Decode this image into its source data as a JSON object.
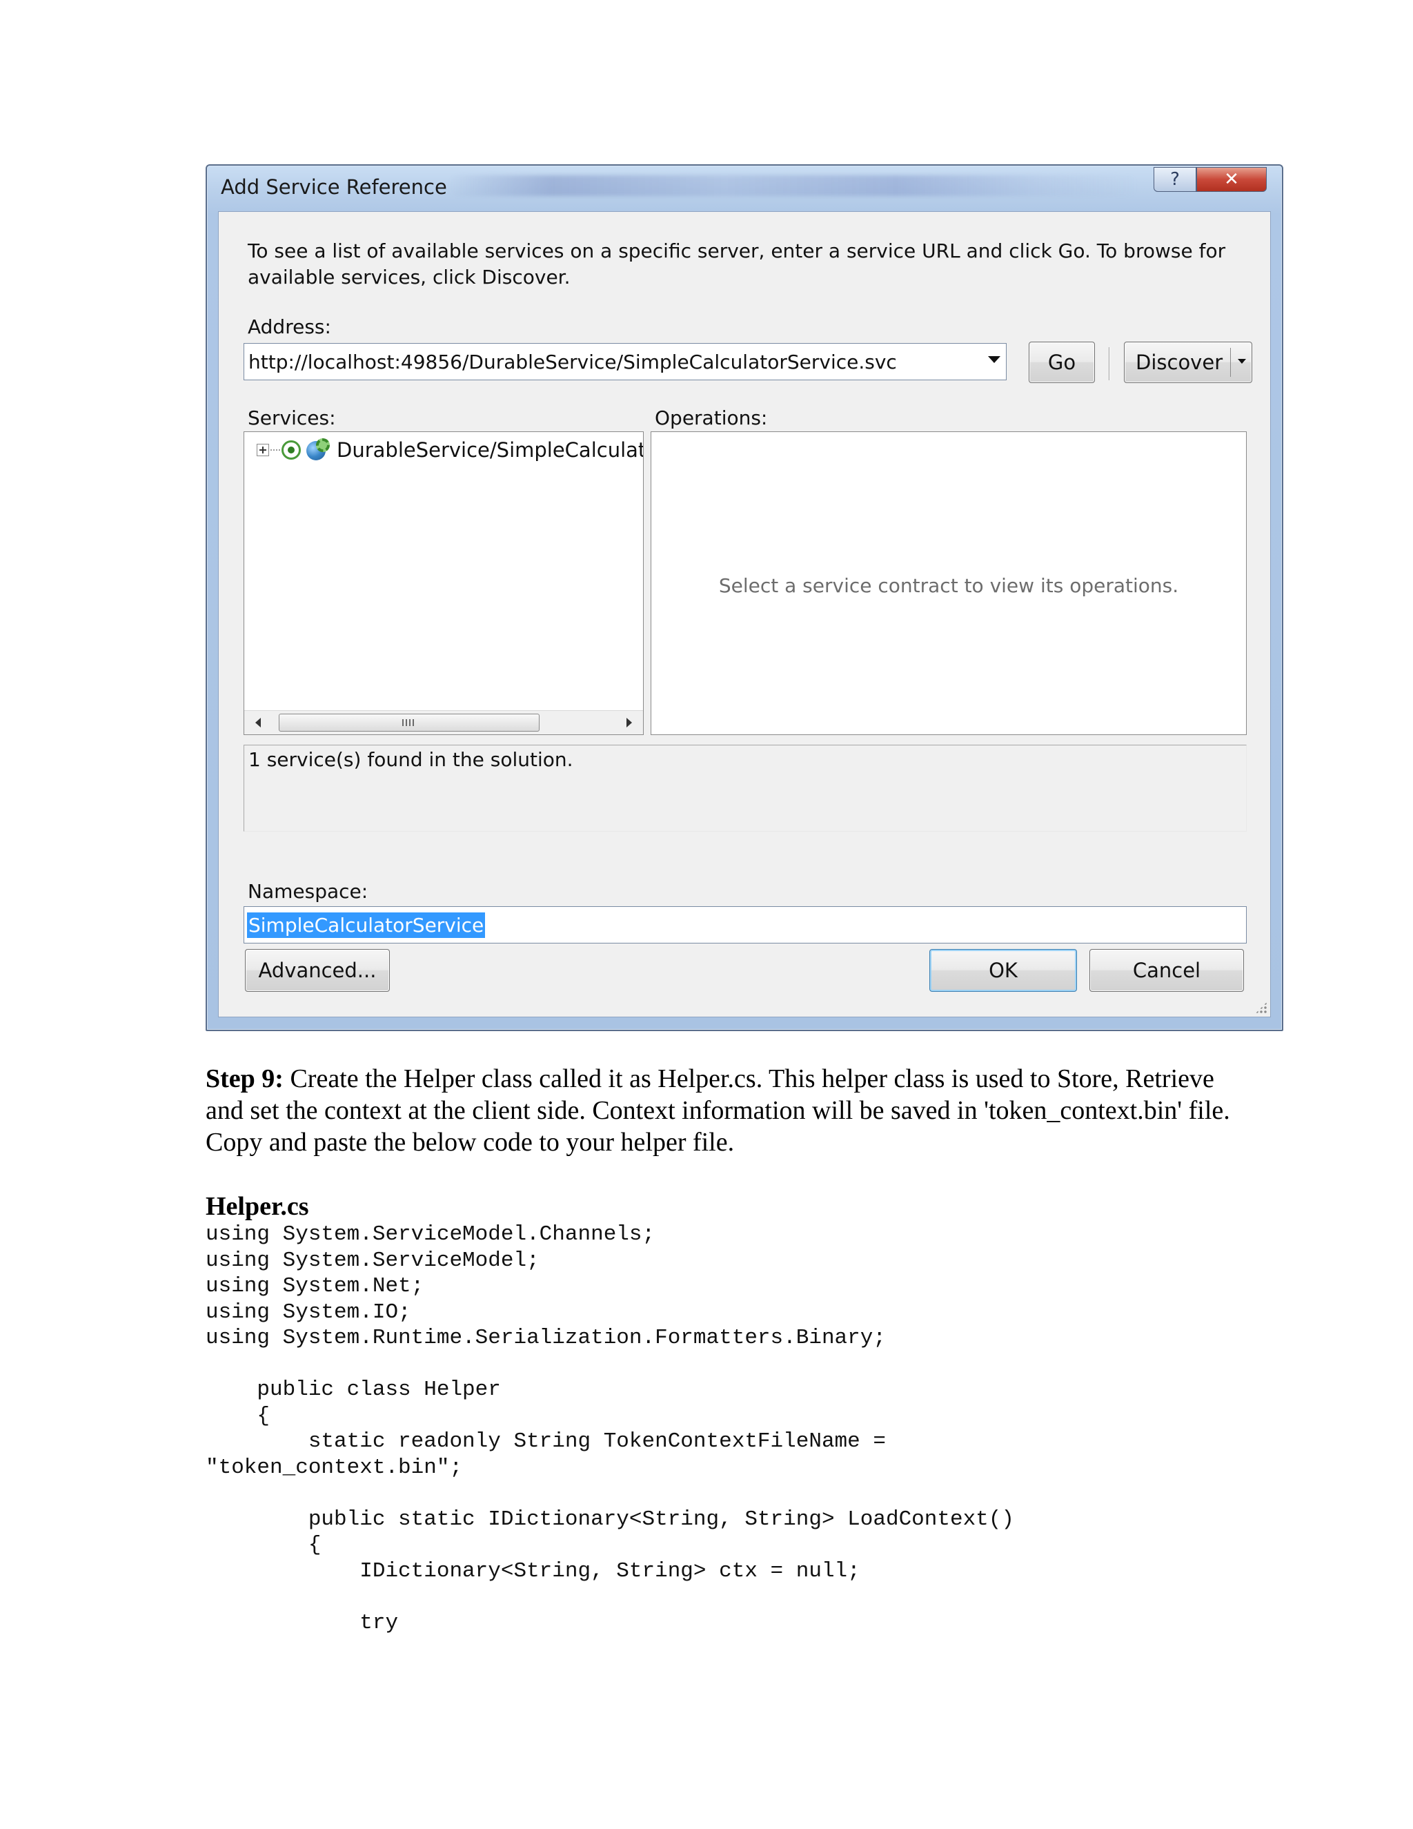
{
  "dialog": {
    "title": "Add Service Reference",
    "help_glyph": "?",
    "close_glyph": "✕",
    "instructions": "To see a list of available services on a specific server, enter a service URL and click Go. To browse for available services, click Discover.",
    "address_label": "Address:",
    "address_value": "http://localhost:49856/DurableService/SimpleCalculatorService.svc",
    "go_label": "Go",
    "discover_label": "Discover",
    "services_label": "Services:",
    "operations_label": "Operations:",
    "service_item": "DurableService/SimpleCalculatorService.svc",
    "operations_hint": "Select a service contract to view its operations.",
    "status_text": "1 service(s) found in the solution.",
    "namespace_label": "Namespace:",
    "namespace_value": "SimpleCalculatorService",
    "advanced_label": "Advanced...",
    "ok_label": "OK",
    "cancel_label": "Cancel"
  },
  "document": {
    "step_label": "Step 9:",
    "step_text": " Create the Helper class called it as Helper.cs. This helper class is used to Store, Retrieve and set the context at the client side. Context information will be saved in 'token_context.bin' file. Copy and paste the below code to your helper file.",
    "code_title": "Helper.cs",
    "code": "using System.ServiceModel.Channels;\nusing System.ServiceModel;\nusing System.Net;\nusing System.IO;\nusing System.Runtime.Serialization.Formatters.Binary;\n\n    public class Helper\n    {\n        static readonly String TokenContextFileName =\n\"token_context.bin\";\n\n        public static IDictionary<String, String> LoadContext()\n        {\n            IDictionary<String, String> ctx = null;\n\n            try"
  }
}
